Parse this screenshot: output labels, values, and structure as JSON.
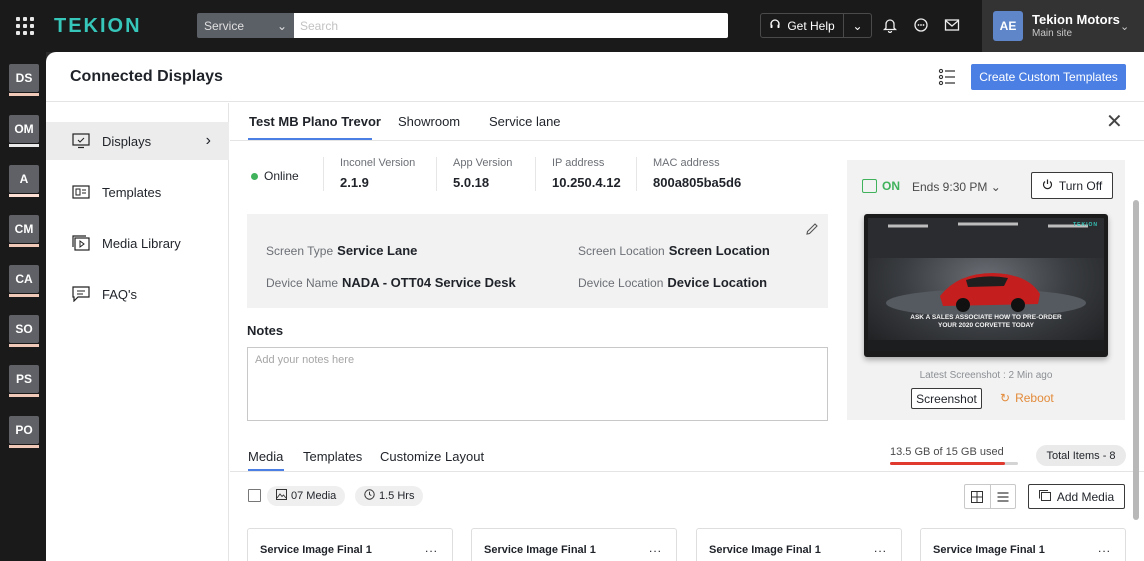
{
  "topbar": {
    "logo": "TEKION",
    "search": {
      "module": "Service",
      "placeholder": "Search"
    },
    "help_label": "Get Help",
    "icons": [
      "apps-grid-icon",
      "headset-icon",
      "bell-icon",
      "chat-icon",
      "mail-icon"
    ],
    "account": {
      "initials": "AE",
      "name": "Tekion Motors",
      "site": "Main site"
    }
  },
  "rail": {
    "items": [
      "DS",
      "OM",
      "A",
      "CM",
      "CA",
      "SO",
      "PS",
      "PO"
    ]
  },
  "page": {
    "title": "Connected Displays",
    "create_button": "Create Custom Templates"
  },
  "side_nav": {
    "items": [
      {
        "label": "Displays",
        "icon": "monitor-icon",
        "active": true
      },
      {
        "label": "Templates",
        "icon": "template-icon",
        "active": false
      },
      {
        "label": "Media Library",
        "icon": "media-library-icon",
        "active": false
      },
      {
        "label": "FAQ's",
        "icon": "faq-icon",
        "active": false
      }
    ]
  },
  "tabs": [
    "Test MB Plano Trevor",
    "Showroom",
    "Service lane"
  ],
  "device": {
    "status": "Online",
    "info": [
      {
        "label": "Inconel Version",
        "value": "2.1.9"
      },
      {
        "label": "App Version",
        "value": "5.0.18"
      },
      {
        "label": "IP address",
        "value": "10.250.4.12"
      },
      {
        "label": "MAC address",
        "value": "800a805ba5d6"
      }
    ],
    "details": {
      "screen_type_label": "Screen Type",
      "screen_type": "Service Lane",
      "screen_location_label": "Screen Location",
      "screen_location": "Screen Location",
      "device_name_label": "Device Name",
      "device_name": "NADA - OTT04 Service Desk",
      "device_location_label": "Device Location",
      "device_location": "Device Location"
    },
    "notes_label": "Notes",
    "notes_placeholder": "Add your notes here"
  },
  "power": {
    "state": "ON",
    "ends": "Ends 9:30 PM",
    "turn_off_label": "Turn Off",
    "screen_caption_line1": "ASK A SALES ASSOCIATE HOW TO PRE-ORDER",
    "screen_caption_line2": "YOUR 2020 CORVETTE TODAY",
    "screen_logo": "TEKION",
    "latest_screenshot": "Latest Screenshot : 2 Min ago",
    "screenshot_label": "Screenshot",
    "reboot_label": "Reboot"
  },
  "media": {
    "tabs": [
      "Media",
      "Templates",
      "Customize Layout"
    ],
    "usage_text": "13.5 GB of 15 GB used",
    "usage_fraction": 0.9,
    "total_items": "Total Items - 8",
    "media_count_chip": "07 Media",
    "duration_chip": "1.5 Hrs",
    "add_media_label": "Add Media",
    "cards": [
      "Service Image Final 1",
      "Service Image Final 1",
      "Service Image Final 1",
      "Service Image Final 1"
    ],
    "card_more": "..."
  },
  "colors": {
    "accent": "#4b7fe3",
    "online": "#3fb25b",
    "reboot": "#e38b3a",
    "usage": "#e03a2f",
    "logo": "#36c6ba"
  }
}
